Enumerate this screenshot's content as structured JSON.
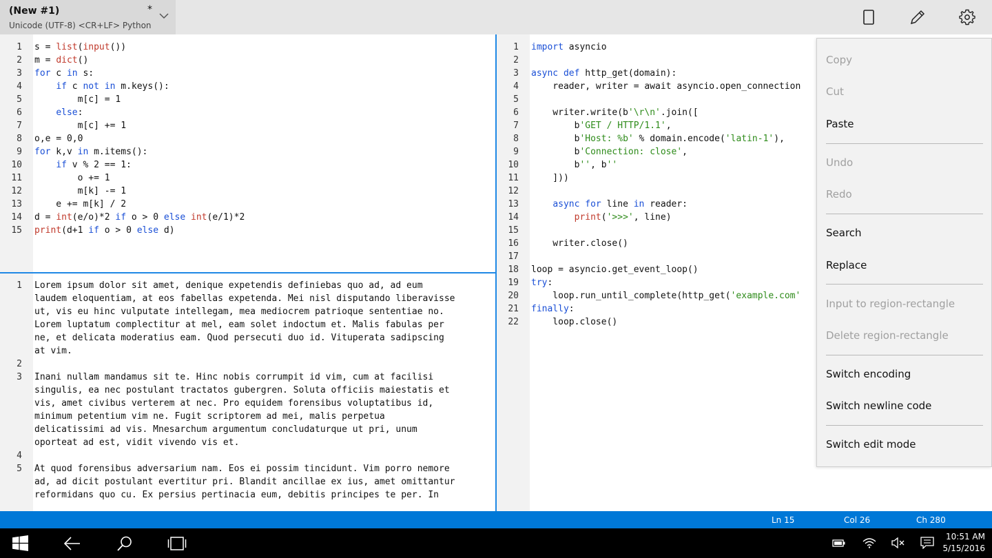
{
  "titlebar": {
    "doc_title": "(New #1)",
    "modified_marker": "*",
    "doc_info": "Unicode (UTF-8) <CR+LF> Python",
    "icons": [
      "chevron-down-icon",
      "tablet-mode-icon",
      "pencil-icon",
      "gear-icon"
    ]
  },
  "editor_left_top": {
    "lines": [
      {
        "n": "1",
        "html": "s = <span class='fn'>list</span>(<span class='fn'>input</span>())"
      },
      {
        "n": "2",
        "html": "m = <span class='fn'>dict</span>()"
      },
      {
        "n": "3",
        "html": "<span class='kw'>for</span> c <span class='kw'>in</span> s:"
      },
      {
        "n": "4",
        "html": "    <span class='kw'>if</span> c <span class='kw'>not</span> <span class='kw'>in</span> m.keys():"
      },
      {
        "n": "5",
        "html": "        m[c] = 1"
      },
      {
        "n": "6",
        "html": "    <span class='kw'>else</span>:"
      },
      {
        "n": "7",
        "html": "        m[c] += 1"
      },
      {
        "n": "8",
        "html": "o,e = 0,0"
      },
      {
        "n": "9",
        "html": "<span class='kw'>for</span> k,v <span class='kw'>in</span> m.items():"
      },
      {
        "n": "10",
        "html": "    <span class='kw'>if</span> v % 2 == 1:"
      },
      {
        "n": "11",
        "html": "        o += 1"
      },
      {
        "n": "12",
        "html": "        m[k] -= 1"
      },
      {
        "n": "13",
        "html": "    e += m[k] / 2"
      },
      {
        "n": "14",
        "html": "d = <span class='fn'>int</span>(e/o)*2 <span class='kw'>if</span> o > 0 <span class='kw'>else</span> <span class='fn'>int</span>(e/1)*2"
      },
      {
        "n": "15",
        "html": "<span class='fn'>print</span>(d+1 <span class='kw'>if</span> o > 0 <span class='kw'>else</span> d)"
      }
    ]
  },
  "editor_left_bottom": {
    "lines": [
      {
        "n": "1",
        "html": "Lorem ipsum dolor sit amet, denique expetendis definiebas quo ad, ad eum"
      },
      {
        "n": "",
        "html": "laudem eloquentiam, at eos fabellas expetenda. Mei nisl disputando liberavisse"
      },
      {
        "n": "",
        "html": "ut, vis eu hinc vulputate intellegam, mea mediocrem patrioque sententiae no."
      },
      {
        "n": "",
        "html": "Lorem luptatum complectitur at mel, eam solet indoctum et. Malis fabulas per"
      },
      {
        "n": "",
        "html": "ne, et delicata moderatius eam. Quod persecuti duo id. Vituperata sadipscing"
      },
      {
        "n": "",
        "html": "at vim."
      },
      {
        "n": "2",
        "html": ""
      },
      {
        "n": "3",
        "html": "Inani nullam mandamus sit te. Hinc nobis corrumpit id vim, cum at facilisi"
      },
      {
        "n": "",
        "html": "singulis, ea nec postulant tractatos gubergren. Soluta officiis maiestatis et"
      },
      {
        "n": "",
        "html": "vis, amet civibus verterem at nec. Pro equidem forensibus voluptatibus id,"
      },
      {
        "n": "",
        "html": "minimum petentium vim ne. Fugit scriptorem ad mei, malis perpetua"
      },
      {
        "n": "",
        "html": "delicatissimi ad vis. Mnesarchum argumentum concludaturque ut pri, unum"
      },
      {
        "n": "",
        "html": "oporteat ad est, vidit vivendo vis et."
      },
      {
        "n": "4",
        "html": ""
      },
      {
        "n": "5",
        "html": "At quod forensibus adversarium nam. Eos ei possim tincidunt. Vim porro nemore"
      },
      {
        "n": "",
        "html": "ad, ad dicit postulant evertitur pri. Blandit ancillae ex ius, amet omittantur"
      },
      {
        "n": "",
        "html": "reformidans quo cu. Ex persius pertinacia eum, debitis principes te per. In"
      }
    ]
  },
  "editor_right": {
    "lines": [
      {
        "n": "1",
        "html": "<span class='kw'>import</span> asyncio"
      },
      {
        "n": "2",
        "html": ""
      },
      {
        "n": "3",
        "html": "<span class='kw'>async</span> <span class='kw'>def</span> http_get(domain):"
      },
      {
        "n": "4",
        "html": "    reader, writer = await asyncio.open_connection"
      },
      {
        "n": "5",
        "html": ""
      },
      {
        "n": "6",
        "html": "    writer.write(b<span class='str'>'\\r\\n'</span>.join(["
      },
      {
        "n": "7",
        "html": "        b<span class='str'>'GET / HTTP/1.1'</span>,"
      },
      {
        "n": "8",
        "html": "        b<span class='str'>'Host: %b'</span> % domain.encode(<span class='str'>'latin-1'</span>),"
      },
      {
        "n": "9",
        "html": "        b<span class='str'>'Connection: close'</span>,"
      },
      {
        "n": "10",
        "html": "        b<span class='str'>''</span>, b<span class='str'>''</span>"
      },
      {
        "n": "11",
        "html": "    ]))"
      },
      {
        "n": "12",
        "html": ""
      },
      {
        "n": "13",
        "html": "    <span class='kw'>async</span> <span class='kw'>for</span> line <span class='kw'>in</span> reader:"
      },
      {
        "n": "14",
        "html": "        <span class='fn'>print</span>(<span class='str'>'>>>'</span>, line)"
      },
      {
        "n": "15",
        "html": ""
      },
      {
        "n": "16",
        "html": "    writer.close()"
      },
      {
        "n": "17",
        "html": ""
      },
      {
        "n": "18",
        "html": "loop = asyncio.get_event_loop()"
      },
      {
        "n": "19",
        "html": "<span class='kw'>try</span>:"
      },
      {
        "n": "20",
        "html": "    loop.run_until_complete(http_get(<span class='str'>'example.com'</span>"
      },
      {
        "n": "21",
        "html": "<span class='kw'>finally</span>:"
      },
      {
        "n": "22",
        "html": "    loop.close()"
      }
    ]
  },
  "context_menu": {
    "copy": "Copy",
    "cut": "Cut",
    "paste": "Paste",
    "undo": "Undo",
    "redo": "Redo",
    "search": "Search",
    "replace": "Replace",
    "input_region": "Input to region-rectangle",
    "delete_region": "Delete region-rectangle",
    "switch_encoding": "Switch encoding",
    "switch_newline": "Switch newline code",
    "switch_edit_mode": "Switch edit mode"
  },
  "statusbar": {
    "ln": "Ln 15",
    "col": "Col 26",
    "ch": "Ch 280"
  },
  "taskbar": {
    "time": "10:51 AM",
    "date": "5/15/2016",
    "icons": [
      "windows-start-icon",
      "back-arrow-icon",
      "search-icon",
      "task-view-icon",
      "battery-icon",
      "wifi-icon",
      "volume-muted-icon",
      "action-center-icon"
    ]
  },
  "colors": {
    "accent": "#0078d7",
    "keyword": "#1a4fd6",
    "builtin": "#c0392b",
    "string": "#2e8b1a"
  }
}
